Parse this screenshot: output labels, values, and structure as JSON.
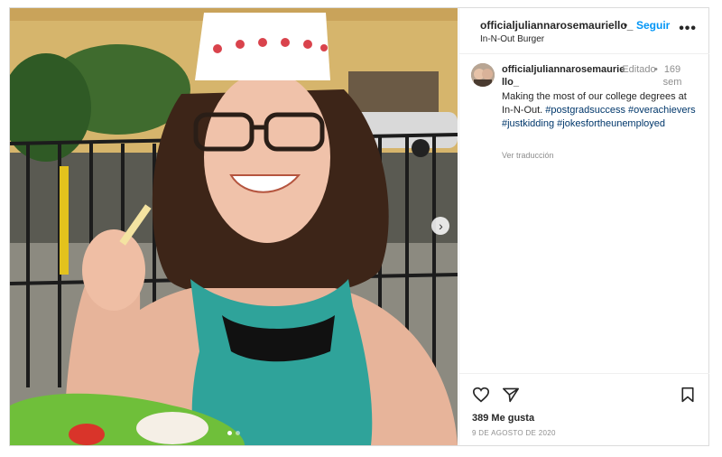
{
  "post": {
    "username": "officialjuliannarosemauriello_",
    "separator": "•",
    "follow_label": "Seguir",
    "location": "In-N-Out Burger",
    "more_label": "•••"
  },
  "comment": {
    "username": "officialjuliannarosemauriello_",
    "edited": "Editado",
    "bullet": "•",
    "ago": "169 sem",
    "caption_text": "Making the most of our college degrees at In-N-Out.",
    "hashtags": [
      "#postgradsuccess",
      "#overachievers",
      "#justkidding",
      "#jokesfortheunemployed"
    ],
    "translate_label": "Ver traducción"
  },
  "actions": {
    "likes": "389 Me gusta",
    "date": "9 DE AGOSTO DE 2020"
  },
  "carousel": {
    "current": 1,
    "total": 2
  },
  "colors": {
    "follow": "#0095f6",
    "hashtag": "#00376b",
    "muted": "#8e8e8e",
    "teal_top": "#2fa39a"
  },
  "icons": [
    "more-icon",
    "heart-icon",
    "share-icon",
    "bookmark-icon",
    "chevron-right-icon"
  ]
}
